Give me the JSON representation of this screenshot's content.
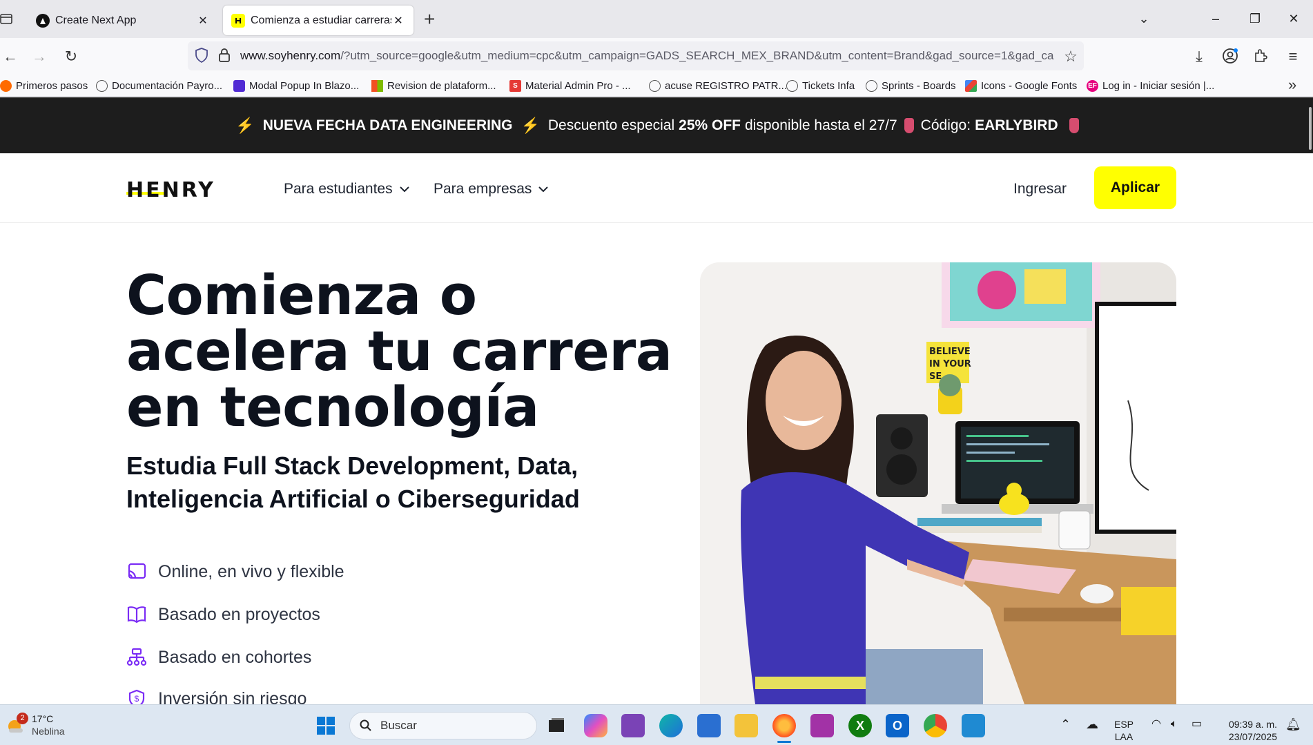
{
  "browser": {
    "tabs": [
      {
        "title": "Create Next App",
        "active": false
      },
      {
        "title": "Comienza a estudiar carreras en tecnología",
        "active": true
      }
    ],
    "new_tab_label": "+",
    "url": {
      "domain": "www.soyhenry.com",
      "rest": "/?utm_source=google&utm_medium=cpc&utm_campaign=GADS_SEARCH_MEX_BRAND&utm_content=Brand&gad_source=1&gad_ca"
    },
    "bookmarks": [
      {
        "label": "Primeros pasos",
        "icon": "firefox-icon",
        "color": "#ff6a00"
      },
      {
        "label": "Documentación Payro...",
        "icon": "globe-icon",
        "color": "#555555"
      },
      {
        "label": "Modal Popup In Blazo...",
        "icon": "blazor-icon",
        "color": "#512bd4"
      },
      {
        "label": "Revision de plataform...",
        "icon": "microsoft-icon",
        "color": "#f25022"
      },
      {
        "label": "Material Admin Pro - ...",
        "icon": "s-icon",
        "color": "#e53935"
      },
      {
        "label": "acuse REGISTRO PATR...",
        "icon": "globe-icon",
        "color": "#555555"
      },
      {
        "label": "Tickets Infa",
        "icon": "globe-icon",
        "color": "#555555"
      },
      {
        "label": "Sprints - Boards",
        "icon": "globe-icon",
        "color": "#555555"
      },
      {
        "label": "Icons - Google Fonts",
        "icon": "google-fonts-icon",
        "color": "#4285f4"
      },
      {
        "label": "Log in - Iniciar sesión |...",
        "icon": "ef-icon",
        "color": "#e6007e"
      }
    ]
  },
  "promo": {
    "headline": "NUEVA FECHA DATA ENGINEERING",
    "text1": "Descuento especial",
    "discount": "25% OFF",
    "text2": "disponible hasta el 27/7",
    "code_label": "Código:",
    "code": "EARLYBIRD"
  },
  "header": {
    "logo": "HENRY",
    "nav": [
      "Para estudiantes",
      "Para empresas"
    ],
    "login": "Ingresar",
    "apply": "Aplicar"
  },
  "hero": {
    "title": "Comienza o acelera tu carrera en tecnología",
    "subtitle": "Estudia Full Stack Development, Data, Inteligencia Artificial o Ciberseguridad",
    "features": [
      {
        "label": "Online, en vivo y flexible",
        "icon": "cast-icon"
      },
      {
        "label": "Basado en proyectos",
        "icon": "book-open-icon"
      },
      {
        "label": "Basado en cohortes",
        "icon": "org-chart-icon"
      },
      {
        "label": "Inversión sin riesgo",
        "icon": "dollar-badge-icon"
      }
    ],
    "accent_color": "#7b2cf5",
    "poster_text": "BELIEVE IN YOUR SE"
  },
  "taskbar": {
    "weather_temp": "17°C",
    "weather_desc": "Neblina",
    "weather_badge": "2",
    "search_placeholder": "Buscar",
    "lang_top": "ESP",
    "lang_bottom": "LAA",
    "time": "09:39 a. m.",
    "date": "23/07/2025"
  }
}
